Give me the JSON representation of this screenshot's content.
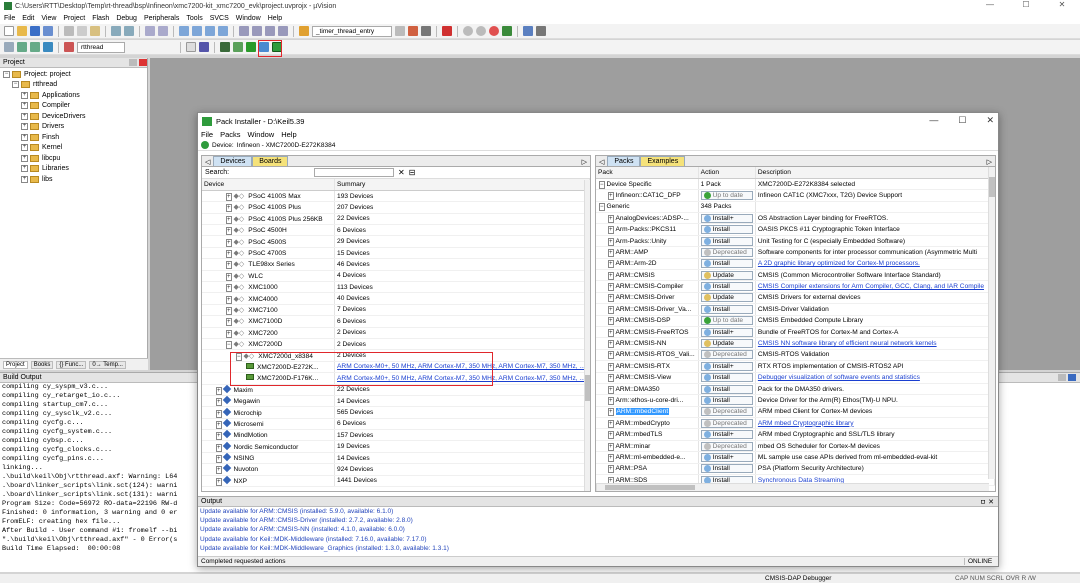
{
  "app": {
    "title": "C:\\Users\\RTT\\Desktop\\Temp\\rt-thread\\bsp\\Infineon\\xmc7200-kit_xmc7200_evk\\project.uvprojx - µVision",
    "menus": [
      "File",
      "Edit",
      "View",
      "Project",
      "Flash",
      "Debug",
      "Peripherals",
      "Tools",
      "SVCS",
      "Window",
      "Help"
    ],
    "toolbar_combo_func": "_timer_thread_entry",
    "toolbar_target": "rtthread",
    "window_buttons": [
      "—",
      "☐",
      "✕"
    ]
  },
  "project_pane": {
    "header": "Project",
    "tree": [
      {
        "label": "Project: project",
        "level": 0,
        "pm": "−"
      },
      {
        "label": "rtthread",
        "level": 1,
        "pm": "−"
      },
      {
        "label": "Applications",
        "level": 2,
        "pm": "+"
      },
      {
        "label": "Compiler",
        "level": 2,
        "pm": "+"
      },
      {
        "label": "DeviceDrivers",
        "level": 2,
        "pm": "+"
      },
      {
        "label": "Drivers",
        "level": 2,
        "pm": "+"
      },
      {
        "label": "Finsh",
        "level": 2,
        "pm": "+"
      },
      {
        "label": "Kernel",
        "level": 2,
        "pm": "+"
      },
      {
        "label": "libcpu",
        "level": 2,
        "pm": "+"
      },
      {
        "label": "Libraries",
        "level": 2,
        "pm": "+"
      },
      {
        "label": "libs",
        "level": 2,
        "pm": "+"
      }
    ],
    "bottom_tabs": [
      "Project",
      "Books",
      "{} Func...",
      "0→ Temp..."
    ]
  },
  "build_output": {
    "header": "Build Output",
    "lines": [
      "compiling cy_syspm_v3.c...",
      "compiling cy_retarget_io.c...",
      "compiling startup_cm7.c...",
      "compiling cy_sysclk_v2.c...",
      "compiling cycfg.c...",
      "compiling cycfg_system.c...",
      "compiling cybsp.c...",
      "compiling cycfg_clocks.c...",
      "compiling cycfg_pins.c...",
      "linking...",
      ".\\build\\keil\\Obj\\rtthread.axf: Warning: L64",
      ".\\board\\linker_scripts\\link.sct(124): warni",
      ".\\board\\linker_scripts\\link.sct(131): warni",
      "Program Size: Code=56972 RO-data=22196 RW-d",
      "Finished: 0 information, 3 warning and 0 er",
      "FromELF: creating hex file...",
      "After Build - User command #1: fromelf --bi",
      "\".\\build\\keil\\Obj\\rtthread.axf\" - 0 Error(s",
      "Build Time Elapsed:  00:00:08"
    ]
  },
  "pack_installer": {
    "title": "Pack Installer - D:\\Keil5.39",
    "menus": [
      "File",
      "Packs",
      "Window",
      "Help"
    ],
    "device_label": "Device:",
    "device_value": "Infineon - XMC7200D-E272K8384",
    "left_tabs": [
      "Devices",
      "Boards"
    ],
    "search_label": "Search:",
    "left_columns": [
      "Device",
      "Summary"
    ],
    "devices": [
      {
        "name": "PSoC 4100S Max",
        "summary": "193 Devices",
        "kind": "ms",
        "indent": 2,
        "pm": "+"
      },
      {
        "name": "PSoC 4100S Plus",
        "summary": "207 Devices",
        "kind": "ms",
        "indent": 2,
        "pm": "+"
      },
      {
        "name": "PSoC 4100S Plus 256KB",
        "summary": "22 Devices",
        "kind": "ms",
        "indent": 2,
        "pm": "+"
      },
      {
        "name": "PSoC 4500H",
        "summary": "6 Devices",
        "kind": "ms",
        "indent": 2,
        "pm": "+"
      },
      {
        "name": "PSoC 4500S",
        "summary": "29 Devices",
        "kind": "ms",
        "indent": 2,
        "pm": "+"
      },
      {
        "name": "PSoC 4700S",
        "summary": "15 Devices",
        "kind": "ms",
        "indent": 2,
        "pm": "+"
      },
      {
        "name": "TLE98xx Series",
        "summary": "46 Devices",
        "kind": "ms",
        "indent": 2,
        "pm": "+"
      },
      {
        "name": "WLC",
        "summary": "4 Devices",
        "kind": "ms",
        "indent": 2,
        "pm": "+"
      },
      {
        "name": "XMC1000",
        "summary": "113 Devices",
        "kind": "ms",
        "indent": 2,
        "pm": "+"
      },
      {
        "name": "XMC4000",
        "summary": "40 Devices",
        "kind": "ms",
        "indent": 2,
        "pm": "+"
      },
      {
        "name": "XMC7100",
        "summary": "7 Devices",
        "kind": "ms",
        "indent": 2,
        "pm": "+"
      },
      {
        "name": "XMC7100D",
        "summary": "6 Devices",
        "kind": "ms",
        "indent": 2,
        "pm": "+"
      },
      {
        "name": "XMC7200",
        "summary": "2 Devices",
        "kind": "ms",
        "indent": 2,
        "pm": "+"
      },
      {
        "name": "XMC7200D",
        "summary": "2 Devices",
        "kind": "ms",
        "indent": 2,
        "pm": "−"
      },
      {
        "name": "XMC7200d_x8384",
        "summary": "2 Devices",
        "kind": "ms",
        "indent": 3,
        "pm": "−"
      },
      {
        "name": "XMC7200D-E272K...",
        "summary": "ARM Cortex-M0+, 50 MHz, ARM Cortex-M7, 350 MHz, ARM Cortex-M7, 350 MHz, ...",
        "kind": "chip",
        "indent": 4,
        "pm": ""
      },
      {
        "name": "XMC7200D-F176K...",
        "summary": "ARM Cortex-M0+, 50 MHz, ARM Cortex-M7, 350 MHz, ARM Cortex-M7, 350 MHz, ...",
        "kind": "chip",
        "indent": 4,
        "pm": ""
      },
      {
        "name": "Maxim",
        "summary": "22 Devices",
        "kind": "dia",
        "indent": 1,
        "pm": "+"
      },
      {
        "name": "Megawin",
        "summary": "14 Devices",
        "kind": "dia",
        "indent": 1,
        "pm": "+"
      },
      {
        "name": "Microchip",
        "summary": "565 Devices",
        "kind": "dia",
        "indent": 1,
        "pm": "+"
      },
      {
        "name": "Microsemi",
        "summary": "6 Devices",
        "kind": "dia",
        "indent": 1,
        "pm": "+"
      },
      {
        "name": "MindMotion",
        "summary": "157 Devices",
        "kind": "dia",
        "indent": 1,
        "pm": "+"
      },
      {
        "name": "Nordic Semiconductor",
        "summary": "19 Devices",
        "kind": "dia",
        "indent": 1,
        "pm": "+"
      },
      {
        "name": "NSING",
        "summary": "14 Devices",
        "kind": "dia",
        "indent": 1,
        "pm": "+"
      },
      {
        "name": "Nuvoton",
        "summary": "924 Devices",
        "kind": "dia",
        "indent": 1,
        "pm": "+"
      },
      {
        "name": "NXP",
        "summary": "1441 Devices",
        "kind": "dia",
        "indent": 1,
        "pm": "+"
      }
    ],
    "right_tabs": [
      "Packs",
      "Examples"
    ],
    "right_columns": [
      "Pack",
      "Action",
      "Description"
    ],
    "packs": [
      {
        "pack": "Device Specific",
        "pm": "−",
        "indent": 0,
        "action": "1 Pack",
        "act_type": "text",
        "desc": "XMC7200D-E272K8384 selected",
        "link": false
      },
      {
        "pack": "Infineon::CAT1C_DFP",
        "pm": "+",
        "indent": 1,
        "action": "Up to date",
        "act_type": "uptodate",
        "desc": "Infineon CAT1C (XMC7xxx, T2G) Device Support",
        "link": false
      },
      {
        "pack": "Generic",
        "pm": "−",
        "indent": 0,
        "action": "348 Packs",
        "act_type": "text",
        "desc": "",
        "link": false
      },
      {
        "pack": "AnalogDevices::ADSP-...",
        "pm": "+",
        "indent": 1,
        "action": "Install+",
        "act_type": "install",
        "desc": "OS Abstraction Layer binding for FreeRTOS.",
        "link": false
      },
      {
        "pack": "Arm-Packs::PKCS11",
        "pm": "+",
        "indent": 1,
        "action": "Install",
        "act_type": "install",
        "desc": "OASIS PKCS #11 Cryptographic Token Interface",
        "link": false
      },
      {
        "pack": "Arm-Packs::Unity",
        "pm": "+",
        "indent": 1,
        "action": "Install",
        "act_type": "install",
        "desc": "Unit Testing for C (especially Embedded Software)",
        "link": false
      },
      {
        "pack": "ARM::AMP",
        "pm": "+",
        "indent": 1,
        "action": "Deprecated",
        "act_type": "deprecated",
        "desc": "Software components for inter processor communication (Asymmetric Multi",
        "link": false
      },
      {
        "pack": "ARM::Arm-2D",
        "pm": "+",
        "indent": 1,
        "action": "Install",
        "act_type": "install",
        "desc": "A 2D graphic library optimized for Cortex-M processors.",
        "link": true
      },
      {
        "pack": "ARM::CMSIS",
        "pm": "+",
        "indent": 1,
        "action": "Update",
        "act_type": "update",
        "desc": "CMSIS (Common Microcontroller Software Interface Standard)",
        "link": false
      },
      {
        "pack": "ARM::CMSIS-Compiler",
        "pm": "+",
        "indent": 1,
        "action": "Install",
        "act_type": "install",
        "desc": "CMSIS Compiler extensions for Arm Compiler, GCC, Clang, and IAR Compile",
        "link": true
      },
      {
        "pack": "ARM::CMSIS-Driver",
        "pm": "+",
        "indent": 1,
        "action": "Update",
        "act_type": "update",
        "desc": "CMSIS Drivers for external devices",
        "link": false
      },
      {
        "pack": "ARM::CMSIS-Driver_Va...",
        "pm": "+",
        "indent": 1,
        "action": "Install",
        "act_type": "install",
        "desc": "CMSIS-Driver Validation",
        "link": false
      },
      {
        "pack": "ARM::CMSIS-DSP",
        "pm": "+",
        "indent": 1,
        "action": "Up to date",
        "act_type": "uptodate",
        "desc": "CMSIS Embedded Compute Library",
        "link": false
      },
      {
        "pack": "ARM::CMSIS-FreeRTOS",
        "pm": "+",
        "indent": 1,
        "action": "Install+",
        "act_type": "install",
        "desc": "Bundle of FreeRTOS for Cortex-M and Cortex-A",
        "link": false
      },
      {
        "pack": "ARM::CMSIS-NN",
        "pm": "+",
        "indent": 1,
        "action": "Update",
        "act_type": "update",
        "desc": "CMSIS NN software library of efficient neural network kernels",
        "link": true
      },
      {
        "pack": "ARM::CMSIS-RTOS_Vali...",
        "pm": "+",
        "indent": 1,
        "action": "Deprecated",
        "act_type": "deprecated",
        "desc": "CMSIS-RTOS Validation",
        "link": false
      },
      {
        "pack": "ARM::CMSIS-RTX",
        "pm": "+",
        "indent": 1,
        "action": "Install+",
        "act_type": "install",
        "desc": "RTX RTOS implementation of CMSIS-RTOS2 API",
        "link": false
      },
      {
        "pack": "ARM::CMSIS-View",
        "pm": "+",
        "indent": 1,
        "action": "Install",
        "act_type": "install",
        "desc": "Debugger visualization of software events and statistics",
        "link": true
      },
      {
        "pack": "ARM::DMA350",
        "pm": "+",
        "indent": 1,
        "action": "Install",
        "act_type": "install",
        "desc": "Pack for the DMA350 drivers.",
        "link": false
      },
      {
        "pack": "Arm::ethos-u-core-dri...",
        "pm": "+",
        "indent": 1,
        "action": "Install",
        "act_type": "install",
        "desc": "Device Driver for the Arm(R) Ethos(TM)-U NPU.",
        "link": false
      },
      {
        "pack": "ARM::mbedClient",
        "pm": "+",
        "indent": 1,
        "action": "Deprecated",
        "act_type": "deprecated",
        "desc": "ARM mbed Client for Cortex-M devices",
        "link": false,
        "selected": true
      },
      {
        "pack": "ARM::mbedCrypto",
        "pm": "+",
        "indent": 1,
        "action": "Deprecated",
        "act_type": "deprecated",
        "desc": "ARM mbed Cryptographic library",
        "link": true
      },
      {
        "pack": "ARM::mbedTLS",
        "pm": "+",
        "indent": 1,
        "action": "Install+",
        "act_type": "install",
        "desc": "ARM mbed Cryptographic and SSL/TLS library",
        "link": false
      },
      {
        "pack": "ARM::minar",
        "pm": "+",
        "indent": 1,
        "action": "Deprecated",
        "act_type": "deprecated",
        "desc": "mbed OS Scheduler for Cortex-M devices",
        "link": false
      },
      {
        "pack": "ARM::ml-embedded-e...",
        "pm": "+",
        "indent": 1,
        "action": "Install+",
        "act_type": "install",
        "desc": "ML sample use case APIs derived from ml-embedded-eval-kit",
        "link": false
      },
      {
        "pack": "ARM::PSA",
        "pm": "+",
        "indent": 1,
        "action": "Install",
        "act_type": "install",
        "desc": "PSA (Platform Security Architecture)",
        "link": false
      },
      {
        "pack": "ARM::SDS",
        "pm": "+",
        "indent": 1,
        "action": "Install",
        "act_type": "install",
        "desc": "Synchronous Data Streaming",
        "link": true
      }
    ],
    "output_header": "Output",
    "output_lines": [
      "Update available for ARM::CMSIS (installed: 5.9.0,  available: 6.1.0)",
      "Update available for ARM::CMSIS-Driver (installed: 2.7.2,  available: 2.8.0)",
      "Update available for ARM::CMSIS-NN (installed: 4.1.0,  available: 6.0.0)",
      "Update available for Keil::MDK-Middleware (installed: 7.16.0,  available: 7.17.0)",
      "Update available for Keil::MDK-Middleware_Graphics (installed: 1.3.0,  available: 1.3.1)"
    ],
    "status_text": "Completed requested actions",
    "status_online": "ONLINE"
  },
  "statusbar": {
    "debugger": "CMSIS-DAP Debugger",
    "indicators": "CAP  NUM  SCRL  OVR  R /W"
  },
  "colors": {
    "accent_blue": "#3399ff",
    "link": "#1a3fd0",
    "highlight_red": "#e0272c",
    "tab_yellow": "#f5e27a"
  }
}
